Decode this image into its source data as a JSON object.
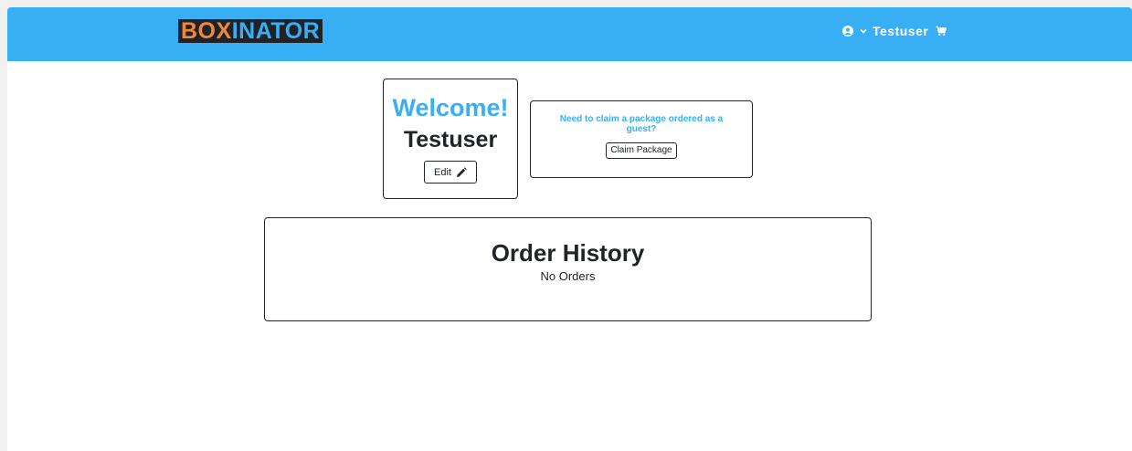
{
  "app": {
    "logo_part_a": "BOX",
    "logo_part_b": "INATOR"
  },
  "navbar": {
    "username": "Testuser",
    "icons": [
      "user-circle-icon",
      "chevron-down-icon",
      "shopping-cart-icon"
    ]
  },
  "welcome_card": {
    "title": "Welcome!",
    "username": "Testuser",
    "edit_label": "Edit",
    "edit_icon": "pencil-icon"
  },
  "claim_card": {
    "prompt": "Need to claim a package ordered as a guest?",
    "button_label": "Claim Package"
  },
  "orders_card": {
    "title": "Order History",
    "empty_message": "No Orders"
  },
  "colors": {
    "navbar": "#38aef5",
    "accent": "#38aef5",
    "logo_orange": "#f0883a",
    "logo_background": "#1f2328",
    "text": "#212529"
  }
}
